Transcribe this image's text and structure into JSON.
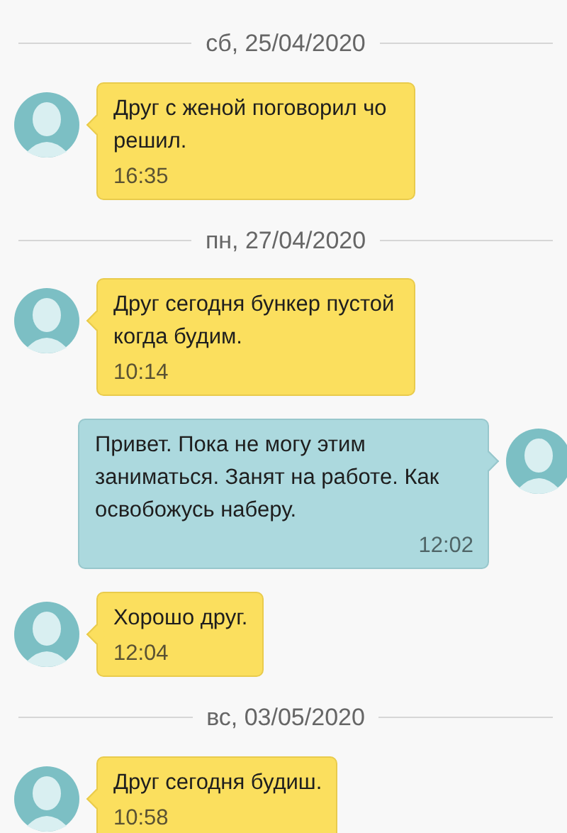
{
  "conversation": [
    {
      "kind": "date",
      "text": "сб, 25/04/2020"
    },
    {
      "kind": "incoming",
      "text": "Друг с женой поговорил чо решил.",
      "time": "16:35"
    },
    {
      "kind": "date",
      "text": "пн, 27/04/2020"
    },
    {
      "kind": "incoming",
      "text": "Друг сегодня бункер пустой когда будим.",
      "time": "10:14"
    },
    {
      "kind": "outgoing",
      "text": "Привет. Пока не могу этим заниматься. Занят на работе. Как освобожусь наберу.",
      "time": "12:02"
    },
    {
      "kind": "incoming",
      "text": "Хорошо друг.",
      "time": "12:04"
    },
    {
      "kind": "date",
      "text": "вс, 03/05/2020"
    },
    {
      "kind": "incoming",
      "text": "Друг сегодня будиш.",
      "time": "10:58"
    }
  ]
}
